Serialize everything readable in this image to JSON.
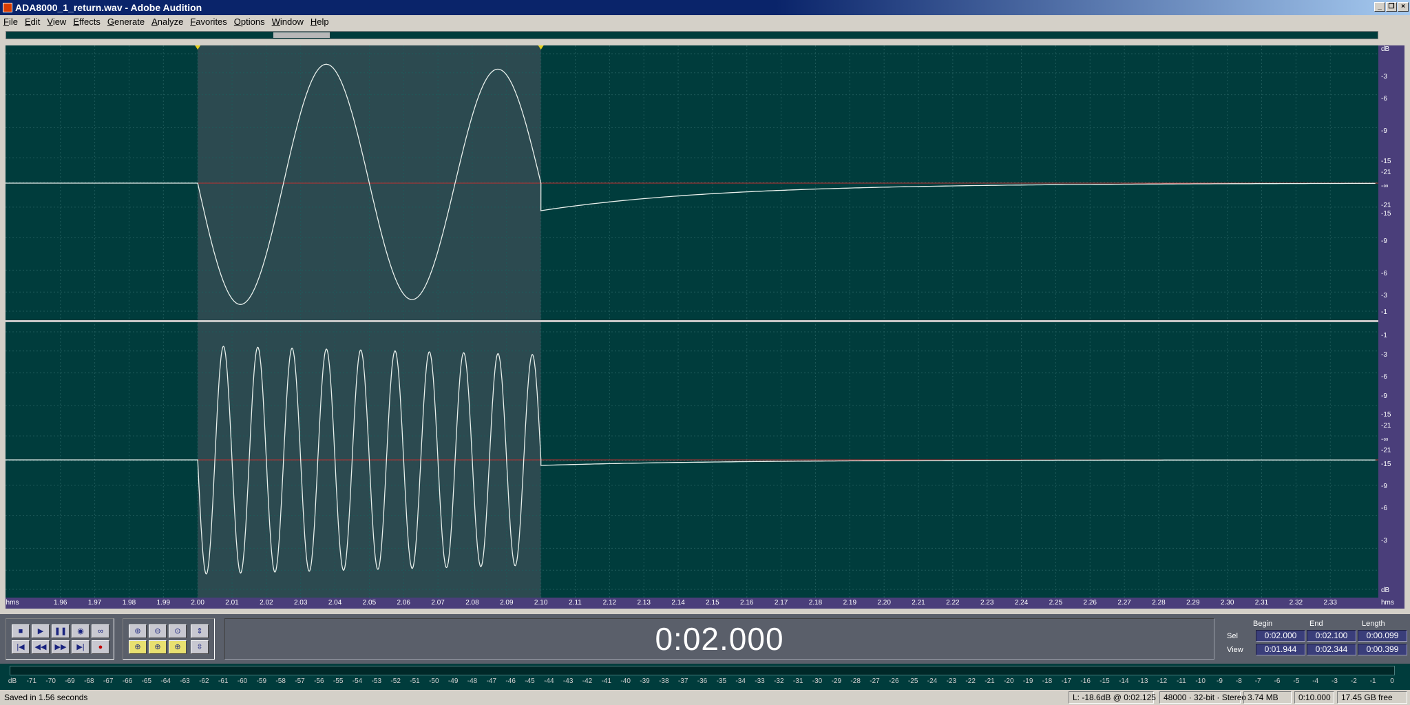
{
  "window": {
    "title": "ADA8000_1_return.wav - Adobe Audition",
    "minimize": "_",
    "restore": "❐",
    "close": "×"
  },
  "menu": [
    "File",
    "Edit",
    "View",
    "Effects",
    "Generate",
    "Analyze",
    "Favorites",
    "Options",
    "Window",
    "Help"
  ],
  "ruler": {
    "unit": "hms",
    "ticks": [
      "1.96",
      "1.97",
      "1.98",
      "1.99",
      "2.00",
      "2.01",
      "2.02",
      "2.03",
      "2.04",
      "2.05",
      "2.06",
      "2.07",
      "2.08",
      "2.09",
      "2.10",
      "2.11",
      "2.12",
      "2.13",
      "2.14",
      "2.15",
      "2.16",
      "2.17",
      "2.18",
      "2.19",
      "2.20",
      "2.21",
      "2.22",
      "2.23",
      "2.24",
      "2.25",
      "2.26",
      "2.27",
      "2.28",
      "2.29",
      "2.30",
      "2.31",
      "2.32",
      "2.33"
    ],
    "db_label": "dB",
    "db_ticks_top": [
      "dB",
      "-3",
      "-6",
      "-9",
      "-15",
      "-21",
      "-∞",
      "-21",
      "-15",
      "-9",
      "-6",
      "-3",
      "-1"
    ],
    "db_ticks_bottom": [
      "-1",
      "-3",
      "-6",
      "-9",
      "-15",
      "-21",
      "-∞",
      "-21",
      "-15",
      "-9",
      "-6",
      "-3",
      "dB"
    ]
  },
  "colors": {
    "wave_bg": "#003c3c",
    "selection": "#2c4a50",
    "waveform": "#e8f0ec",
    "centerline": "#c03030",
    "ruler": "#4a3e7a"
  },
  "time_display": "0:02.000",
  "selection_view": {
    "headers": [
      "Begin",
      "End",
      "Length"
    ],
    "rows": [
      {
        "label": "Sel",
        "begin": "0:02.000",
        "end": "0:02.100",
        "length": "0:00.099"
      },
      {
        "label": "View",
        "begin": "0:01.944",
        "end": "0:02.344",
        "length": "0:00.399"
      }
    ]
  },
  "transport": {
    "buttons": [
      "stop",
      "play",
      "pause",
      "play-to-end",
      "loop",
      "go-to-start",
      "rewind",
      "fast-forward",
      "go-to-end",
      "record"
    ],
    "zoom_buttons": [
      "zoom-in-horizontal",
      "zoom-out-horizontal",
      "zoom-full",
      "zoom-in-vertical",
      "zoom-selection",
      "zoom-left-edge",
      "zoom-right-edge",
      "zoom-out-vertical"
    ]
  },
  "meter_ticks": [
    "dB",
    "-71",
    "-70",
    "-69",
    "-68",
    "-67",
    "-66",
    "-65",
    "-64",
    "-63",
    "-62",
    "-61",
    "-60",
    "-59",
    "-58",
    "-57",
    "-56",
    "-55",
    "-54",
    "-53",
    "-52",
    "-51",
    "-50",
    "-49",
    "-48",
    "-47",
    "-46",
    "-45",
    "-44",
    "-43",
    "-42",
    "-41",
    "-40",
    "-39",
    "-38",
    "-37",
    "-36",
    "-35",
    "-34",
    "-33",
    "-32",
    "-31",
    "-30",
    "-29",
    "-28",
    "-27",
    "-26",
    "-25",
    "-24",
    "-23",
    "-22",
    "-21",
    "-20",
    "-19",
    "-18",
    "-17",
    "-16",
    "-15",
    "-14",
    "-13",
    "-12",
    "-11",
    "-10",
    "-9",
    "-8",
    "-7",
    "-6",
    "-5",
    "-4",
    "-3",
    "-2",
    "-1",
    "0"
  ],
  "status": {
    "message": "Saved in 1.56 seconds",
    "level": "L: -18.6dB @  0:02.125",
    "format": "48000 · 32-bit · Stereo",
    "size": "3.74 MB",
    "duration": "0:10.000",
    "free": "17.45 GB free"
  }
}
